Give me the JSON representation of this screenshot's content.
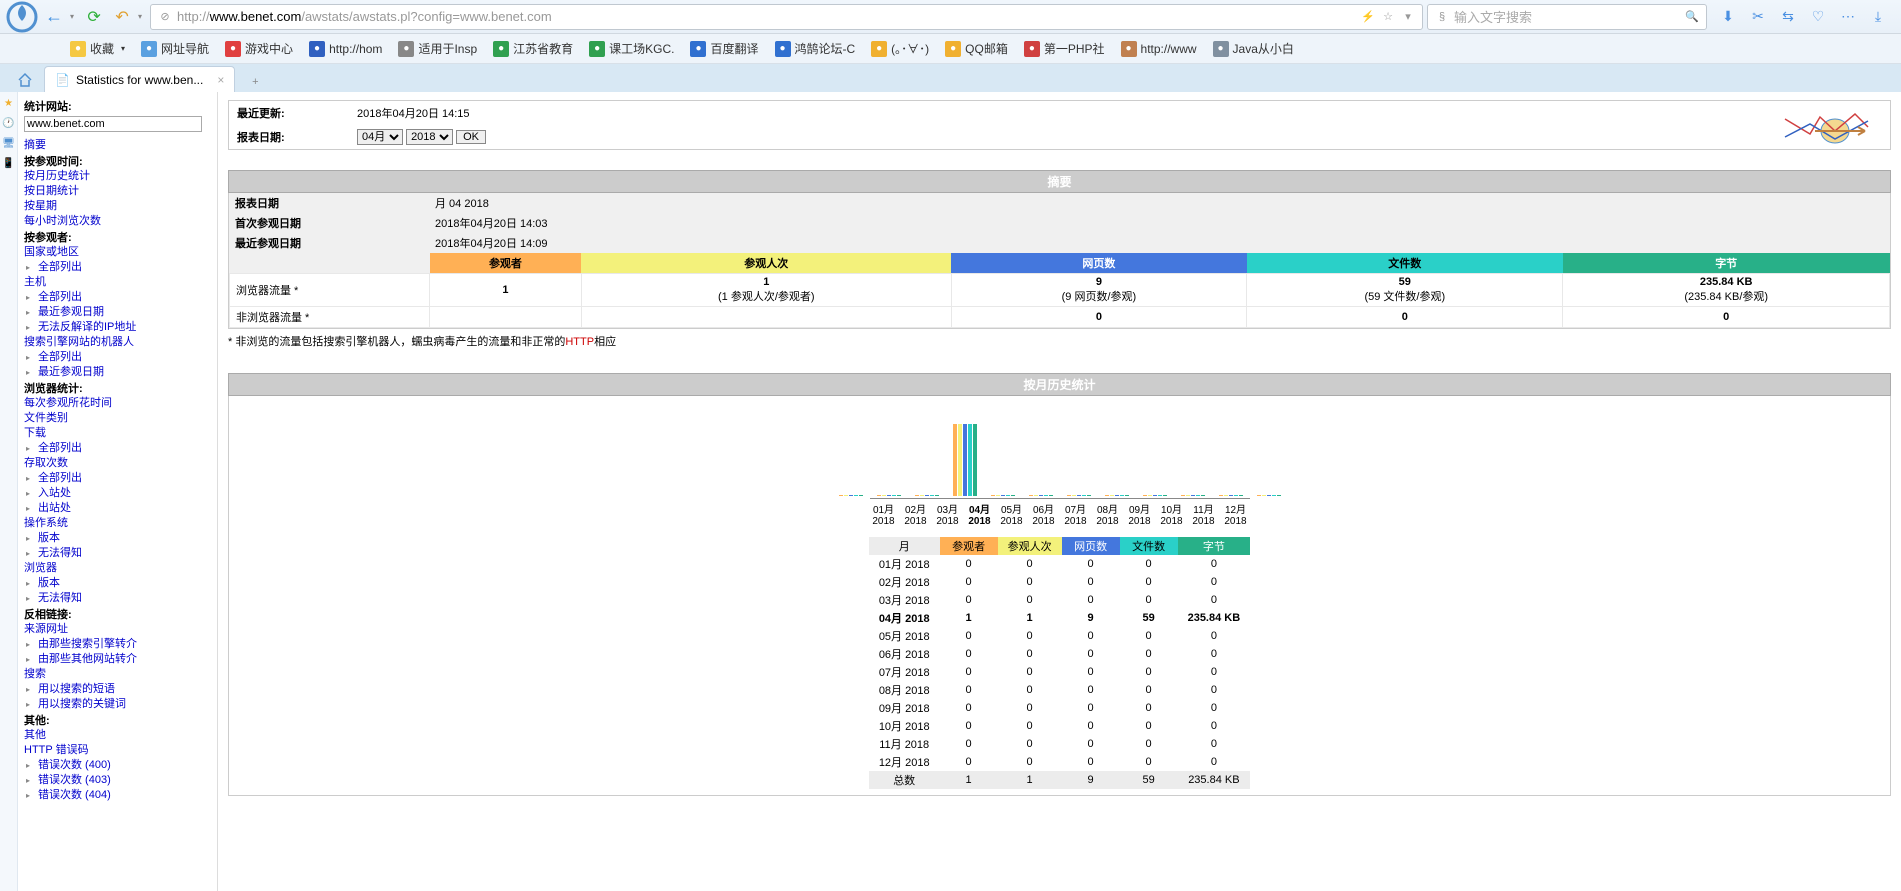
{
  "browser": {
    "url_grey_prefix": "http://",
    "url_host": "www.benet.com",
    "url_grey_mid": "/awstats/awstats.pl?config=",
    "url_tail": "www.benet.com",
    "search_placeholder": "输入文字搜索",
    "tab_title": "Statistics for www.ben...",
    "bookmarks": [
      {
        "label": "收藏",
        "color": "#f5c842"
      },
      {
        "label": "网址导航",
        "color": "#5aa0e0"
      },
      {
        "label": "游戏中心",
        "color": "#e04040"
      },
      {
        "label": "http://hom",
        "color": "#3060c0"
      },
      {
        "label": "适用于Insp",
        "color": "#888"
      },
      {
        "label": "江苏省教育",
        "color": "#30a050"
      },
      {
        "label": "课工场KGC.",
        "color": "#30a050"
      },
      {
        "label": "百度翻译",
        "color": "#3070d0"
      },
      {
        "label": "鸿鹄论坛-C",
        "color": "#3070d0"
      },
      {
        "label": "(｡･∀･)",
        "color": "#f0b030"
      },
      {
        "label": "QQ邮箱",
        "color": "#f0b030"
      },
      {
        "label": "第一PHP社",
        "color": "#d04040"
      },
      {
        "label": "http://www",
        "color": "#c08050"
      },
      {
        "label": "Java从小白",
        "color": "#8090a0"
      }
    ]
  },
  "sidebar": {
    "stats_site_label": "统计网站:",
    "stats_site_value": "www.benet.com",
    "summary": "摘要",
    "when_heading": "按参观时间:",
    "when": [
      "按月历史统计",
      "按日期统计",
      "按星期",
      "每小时浏览次数"
    ],
    "who_heading": "按参观者:",
    "who": [
      {
        "t": "国家或地区"
      },
      {
        "t": "全部列出",
        "i": 1
      },
      {
        "t": "主机"
      },
      {
        "t": "全部列出",
        "i": 1
      },
      {
        "t": "最近参观日期",
        "i": 1
      },
      {
        "t": "无法反解译的IP地址",
        "i": 1
      },
      {
        "t": "搜索引擎网站的机器人"
      },
      {
        "t": "全部列出",
        "i": 1
      },
      {
        "t": "最近参观日期",
        "i": 1
      }
    ],
    "nav_heading": "浏览器统计:",
    "nav": [
      "每次参观所花时间",
      "文件类别",
      "下载"
    ],
    "nav2": [
      {
        "t": "全部列出",
        "i": 1
      },
      {
        "t": "存取次数"
      },
      {
        "t": "全部列出",
        "i": 1
      },
      {
        "t": "入站处",
        "i": 1
      },
      {
        "t": "出站处",
        "i": 1
      },
      {
        "t": "操作系统"
      },
      {
        "t": "版本",
        "i": 1
      },
      {
        "t": "无法得知",
        "i": 1
      },
      {
        "t": "浏览器"
      },
      {
        "t": "版本",
        "i": 1
      },
      {
        "t": "无法得知",
        "i": 1
      }
    ],
    "ref_heading": "反相链接:",
    "ref": [
      {
        "t": "来源网址"
      },
      {
        "t": "由那些搜索引擎转介",
        "i": 1
      },
      {
        "t": "由那些其他网站转介",
        "i": 1
      },
      {
        "t": "搜索"
      },
      {
        "t": "用以搜索的短语",
        "i": 1
      },
      {
        "t": "用以搜索的关键词",
        "i": 1
      }
    ],
    "other_heading": "其他:",
    "other": [
      {
        "t": "其他"
      },
      {
        "t": "HTTP 错误码"
      },
      {
        "t": "错误次数 (400)",
        "i": 1
      },
      {
        "t": "错误次数 (403)",
        "i": 1
      },
      {
        "t": "错误次数 (404)",
        "i": 1
      }
    ]
  },
  "top": {
    "last_update_label": "最近更新:",
    "last_update_value": "2018年04月20日 14:15",
    "report_date_label": "报表日期:",
    "month_value": "04月",
    "year_value": "2018",
    "ok": "OK"
  },
  "summary": {
    "title": "摘要",
    "meta": [
      {
        "k": "报表日期",
        "v": "月 04 2018"
      },
      {
        "k": "首次参观日期",
        "v": "2018年04月20日 14:03"
      },
      {
        "k": "最近参观日期",
        "v": "2018年04月20日 14:09"
      }
    ],
    "headers": [
      "参观者",
      "参观人次",
      "网页数",
      "文件数",
      "字节"
    ],
    "row_labels": [
      "浏览器流量 *",
      "非浏览器流量 *"
    ],
    "rows": [
      [
        "1",
        "1",
        "9",
        "59",
        "235.84 KB"
      ],
      [
        "",
        "",
        "0",
        "0",
        "0"
      ]
    ],
    "sub": [
      "",
      "(1 参观人次/参观者)",
      "(9 网页数/参观)",
      "(59 文件数/参观)",
      "(235.84 KB/参观)"
    ],
    "note_text": "* 非浏览的流量包括搜索引擎机器人，蠕虫病毒产生的流量和非正常的",
    "note_red": "HTTP",
    "note_tail": "相应"
  },
  "history": {
    "title": "按月历史统计",
    "months_short": [
      "01月",
      "02月",
      "03月",
      "04月",
      "05月",
      "06月",
      "07月",
      "08月",
      "09月",
      "10月",
      "11月",
      "12月"
    ],
    "year": "2018",
    "current_idx": 3,
    "headers": [
      "月",
      "参观者",
      "参观人次",
      "网页数",
      "文件数",
      "字节"
    ],
    "rows": [
      {
        "m": "01月 2018",
        "v": "0",
        "vi": "0",
        "p": "0",
        "f": "0",
        "b": "0"
      },
      {
        "m": "02月 2018",
        "v": "0",
        "vi": "0",
        "p": "0",
        "f": "0",
        "b": "0"
      },
      {
        "m": "03月 2018",
        "v": "0",
        "vi": "0",
        "p": "0",
        "f": "0",
        "b": "0"
      },
      {
        "m": "04月 2018",
        "v": "1",
        "vi": "1",
        "p": "9",
        "f": "59",
        "b": "235.84 KB"
      },
      {
        "m": "05月 2018",
        "v": "0",
        "vi": "0",
        "p": "0",
        "f": "0",
        "b": "0"
      },
      {
        "m": "06月 2018",
        "v": "0",
        "vi": "0",
        "p": "0",
        "f": "0",
        "b": "0"
      },
      {
        "m": "07月 2018",
        "v": "0",
        "vi": "0",
        "p": "0",
        "f": "0",
        "b": "0"
      },
      {
        "m": "08月 2018",
        "v": "0",
        "vi": "0",
        "p": "0",
        "f": "0",
        "b": "0"
      },
      {
        "m": "09月 2018",
        "v": "0",
        "vi": "0",
        "p": "0",
        "f": "0",
        "b": "0"
      },
      {
        "m": "10月 2018",
        "v": "0",
        "vi": "0",
        "p": "0",
        "f": "0",
        "b": "0"
      },
      {
        "m": "11月 2018",
        "v": "0",
        "vi": "0",
        "p": "0",
        "f": "0",
        "b": "0"
      },
      {
        "m": "12月 2018",
        "v": "0",
        "vi": "0",
        "p": "0",
        "f": "0",
        "b": "0"
      }
    ],
    "total": {
      "m": "总数",
      "v": "1",
      "vi": "1",
      "p": "9",
      "f": "59",
      "b": "235.84 KB"
    }
  },
  "chart_data": {
    "type": "bar",
    "categories": [
      "01月",
      "02月",
      "03月",
      "04月",
      "05月",
      "06月",
      "07月",
      "08月",
      "09月",
      "10月",
      "11月",
      "12月"
    ],
    "series": [
      {
        "name": "参观者",
        "values": [
          0,
          0,
          0,
          1,
          0,
          0,
          0,
          0,
          0,
          0,
          0,
          0
        ],
        "color": "#ffb055"
      },
      {
        "name": "参观人次",
        "values": [
          0,
          0,
          0,
          1,
          0,
          0,
          0,
          0,
          0,
          0,
          0,
          0
        ],
        "color": "#f3f17b"
      },
      {
        "name": "网页数",
        "values": [
          0,
          0,
          0,
          9,
          0,
          0,
          0,
          0,
          0,
          0,
          0,
          0
        ],
        "color": "#4477dd"
      },
      {
        "name": "文件数",
        "values": [
          0,
          0,
          0,
          59,
          0,
          0,
          0,
          0,
          0,
          0,
          0,
          0
        ],
        "color": "#2ad0c8"
      },
      {
        "name": "字节(KB)",
        "values": [
          0,
          0,
          0,
          235.84,
          0,
          0,
          0,
          0,
          0,
          0,
          0,
          0
        ],
        "color": "#28b088"
      }
    ],
    "title": "按月历史统计",
    "xlabel": "月",
    "ylabel": ""
  }
}
